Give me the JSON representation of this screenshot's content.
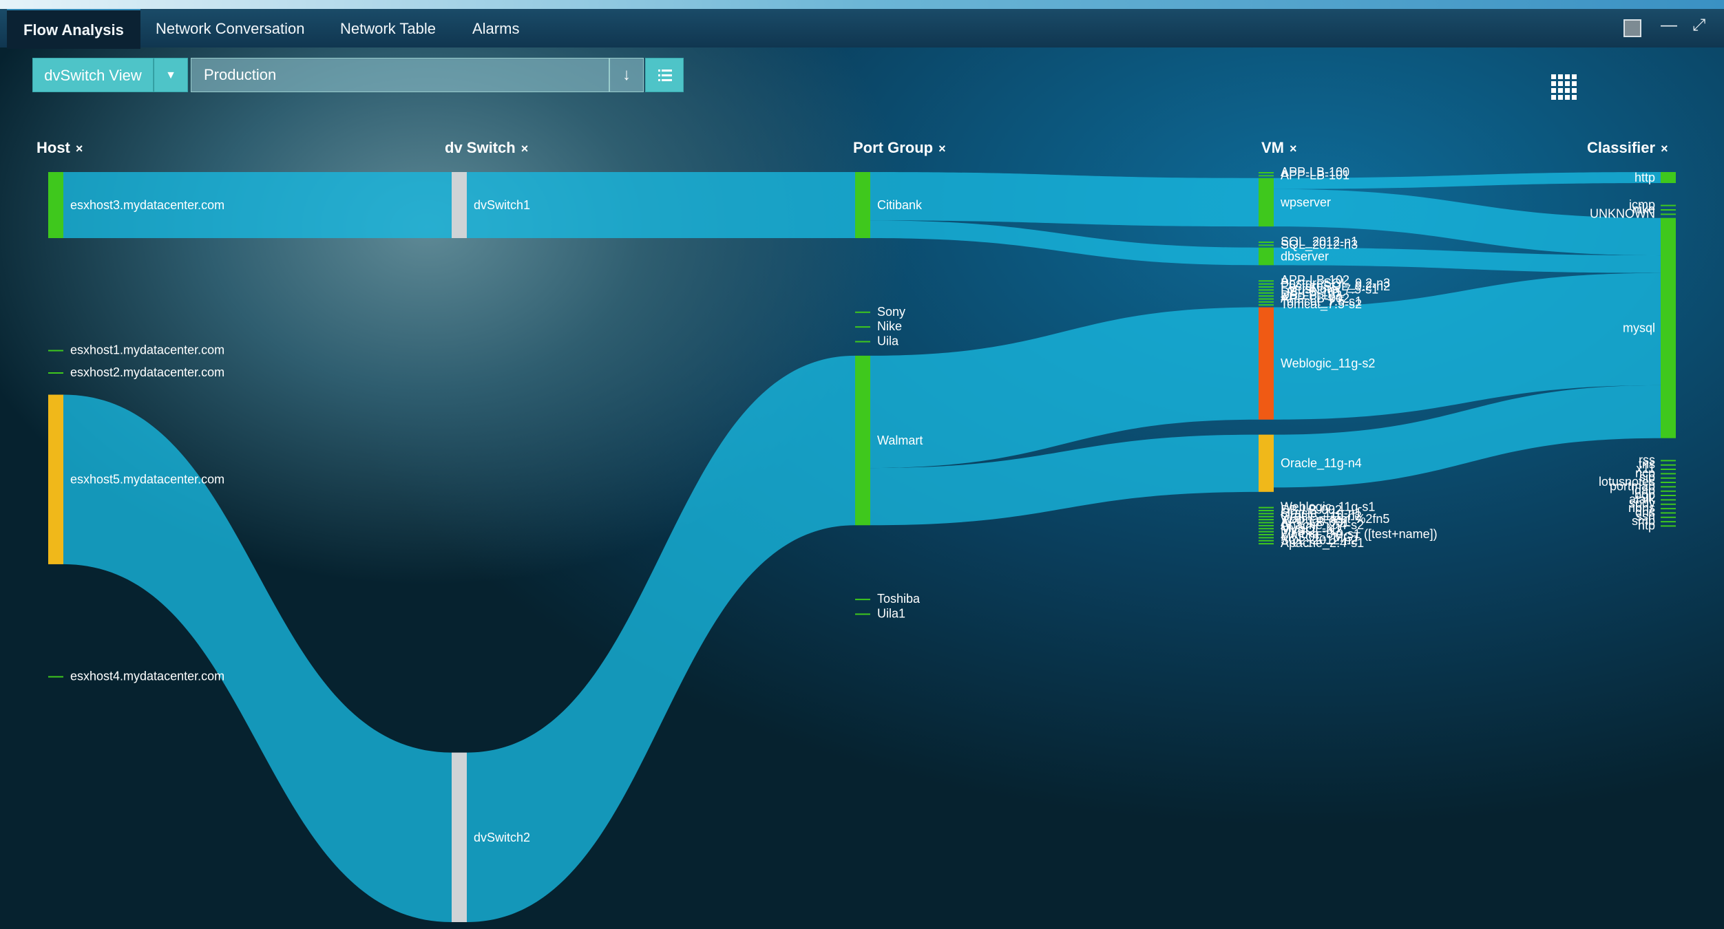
{
  "tabs": [
    "Flow Analysis",
    "Network Conversation",
    "Network Table",
    "Alarms"
  ],
  "toolbar": {
    "view_label": "dvSwitch View",
    "filter_value": "Production"
  },
  "columns": [
    {
      "label": "Host",
      "close": "×"
    },
    {
      "label": "dv Switch",
      "close": "×"
    },
    {
      "label": "Port Group",
      "close": "×"
    },
    {
      "label": "VM",
      "close": "×"
    },
    {
      "label": "Classifier",
      "close": "×"
    }
  ],
  "colors": {
    "green": "#3fc81d",
    "orange": "#f0b81a",
    "red": "#f05a14",
    "gray": "#cfd3d6",
    "flow": "#18b8e0"
  },
  "nodes": {
    "host": [
      {
        "name": "esxhost3.mydatacenter.com",
        "color": "green",
        "size": 60
      },
      {
        "name": "esxhost1.mydatacenter.com",
        "color": "green",
        "size": 0
      },
      {
        "name": "esxhost2.mydatacenter.com",
        "color": "green",
        "size": 0
      },
      {
        "name": "esxhost5.mydatacenter.com",
        "color": "orange",
        "size": 154
      },
      {
        "name": "esxhost4.mydatacenter.com",
        "color": "green",
        "size": 0
      }
    ],
    "switch": [
      {
        "name": "dvSwitch1",
        "color": "gray",
        "size": 60
      },
      {
        "name": "dvSwitch2",
        "color": "gray",
        "size": 154
      }
    ],
    "portgroup": [
      {
        "name": "Citibank",
        "color": "green",
        "size": 60
      },
      {
        "name": "Sony",
        "color": "green",
        "size": 0
      },
      {
        "name": "Nike",
        "color": "green",
        "size": 0
      },
      {
        "name": "Uila",
        "color": "green",
        "size": 0
      },
      {
        "name": "Walmart",
        "color": "green",
        "size": 154
      },
      {
        "name": "Toshiba",
        "color": "green",
        "size": 0
      },
      {
        "name": "Uila1",
        "color": "green",
        "size": 0
      }
    ],
    "vm": [
      {
        "name": "APP-LB-100",
        "color": "green",
        "size": 0
      },
      {
        "name": "APP-LB-101",
        "color": "green",
        "size": 0
      },
      {
        "name": "wpserver",
        "color": "green",
        "size": 44
      },
      {
        "name": "SQL_2012-n1",
        "color": "green",
        "size": 0
      },
      {
        "name": "SQL_2012-n3",
        "color": "green",
        "size": 0
      },
      {
        "name": "dbserver",
        "color": "green",
        "size": 16
      },
      {
        "name": "APP-LB-102",
        "color": "green",
        "size": 0
      },
      {
        "name": "PostgreSQL_9.2-n3",
        "color": "green",
        "size": 0
      },
      {
        "name": "PostgreSQL_9.2-n2",
        "color": "green",
        "size": 0
      },
      {
        "name": "LotusNote_7.5-s1",
        "color": "green",
        "size": 0
      },
      {
        "name": "DB-LB-101",
        "color": "green",
        "size": 0
      },
      {
        "name": "DB-LB-102",
        "color": "green",
        "size": 0
      },
      {
        "name": "APP-LB-002",
        "color": "green",
        "size": 0
      },
      {
        "name": "Tomcat_7.5-s1",
        "color": "green",
        "size": 0
      },
      {
        "name": "Tomcat_7.5-s2",
        "color": "green",
        "size": 0
      },
      {
        "name": "Weblogic_11g-s2",
        "color": "red",
        "size": 102
      },
      {
        "name": "Oracle_11g-n4",
        "color": "orange",
        "size": 52
      },
      {
        "name": "Weblogic_11g-s1",
        "color": "green",
        "size": 0
      },
      {
        "name": "DB-LB-002",
        "color": "green",
        "size": 0
      },
      {
        "name": "Oracle_11g-n1",
        "color": "green",
        "size": 0
      },
      {
        "name": "Oracle_11g-n2",
        "color": "green",
        "size": 0
      },
      {
        "name": "Walmart-test-%2fn5",
        "color": "green",
        "size": 0
      },
      {
        "name": "APP-LB-001",
        "color": "green",
        "size": 0
      },
      {
        "name": "Apache_2.4-s2",
        "color": "green",
        "size": 0
      },
      {
        "name": "MySQL-N1",
        "color": "green",
        "size": 0
      },
      {
        "name": "MySQL-N2",
        "color": "green",
        "size": 0
      },
      {
        "name": "Zimbra_8.0-s1 ([test+name])",
        "color": "green",
        "size": 0
      },
      {
        "name": "MySQL-_MGT",
        "color": "green",
        "size": 0
      },
      {
        "name": "SQL_2012-n2",
        "color": "green",
        "size": 0
      },
      {
        "name": "Apache_2.4-s1",
        "color": "green",
        "size": 0
      }
    ],
    "classifier": [
      {
        "name": "http",
        "color": "green",
        "size": 10
      },
      {
        "name": "icmp",
        "color": "green",
        "size": 0
      },
      {
        "name": "nike",
        "color": "green",
        "size": 0
      },
      {
        "name": "UNKNOWN",
        "color": "green",
        "size": 0
      },
      {
        "name": "mysql",
        "color": "green",
        "size": 200
      },
      {
        "name": "rss",
        "color": "green",
        "size": 0
      },
      {
        "name": "tns",
        "color": "green",
        "size": 0
      },
      {
        "name": "x11",
        "color": "green",
        "size": 0
      },
      {
        "name": "ncp",
        "color": "green",
        "size": 0
      },
      {
        "name": "sip",
        "color": "green",
        "size": 0
      },
      {
        "name": "lotusnotes",
        "color": "green",
        "size": 0
      },
      {
        "name": "portmap",
        "color": "green",
        "size": 0
      },
      {
        "name": "ldap",
        "color": "green",
        "size": 0
      },
      {
        "name": "bgp",
        "color": "green",
        "size": 0
      },
      {
        "name": "atalk",
        "color": "green",
        "size": 0
      },
      {
        "name": "spdy",
        "color": "green",
        "size": 0
      },
      {
        "name": "nbns",
        "color": "green",
        "size": 0
      },
      {
        "name": "dns",
        "color": "green",
        "size": 0
      },
      {
        "name": "ssh",
        "color": "green",
        "size": 0
      },
      {
        "name": "smb",
        "color": "green",
        "size": 0
      },
      {
        "name": "ntp",
        "color": "green",
        "size": 0
      }
    ]
  },
  "flows": [
    {
      "from": "esxhost3.mydatacenter.com",
      "to": "dvSwitch1",
      "value": 60
    },
    {
      "from": "esxhost5.mydatacenter.com",
      "to": "dvSwitch2",
      "value": 154
    },
    {
      "from": "dvSwitch1",
      "to": "Citibank",
      "value": 60
    },
    {
      "from": "dvSwitch2",
      "to": "Walmart",
      "value": 154
    },
    {
      "from": "Citibank",
      "to": "wpserver",
      "value": 44
    },
    {
      "from": "Citibank",
      "to": "dbserver",
      "value": 16
    },
    {
      "from": "Walmart",
      "to": "Weblogic_11g-s2",
      "value": 102
    },
    {
      "from": "Walmart",
      "to": "Oracle_11g-n4",
      "value": 52
    },
    {
      "from": "wpserver",
      "to": "http",
      "value": 10
    },
    {
      "from": "wpserver",
      "to": "mysql",
      "value": 34
    },
    {
      "from": "dbserver",
      "to": "mysql",
      "value": 16
    },
    {
      "from": "Weblogic_11g-s2",
      "to": "mysql",
      "value": 102
    },
    {
      "from": "Oracle_11g-n4",
      "to": "mysql",
      "value": 48
    }
  ]
}
